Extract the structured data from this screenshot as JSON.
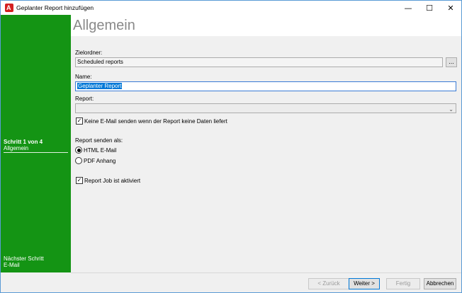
{
  "window": {
    "title": "Geplanter Report hinzufügen",
    "minimize_glyph": "—",
    "maximize_glyph": "☐",
    "close_glyph": "✕"
  },
  "sidebar": {
    "current_step_title": "Schritt 1 von 4",
    "current_step_name": "Allgemein",
    "next_step_title": "Nächster Schritt",
    "next_step_name": "E-Mail",
    "color": "#149414"
  },
  "header": {
    "page_title": "Allgemein"
  },
  "form": {
    "target_folder_label": "Zielordner:",
    "target_folder_value": "Scheduled reports",
    "browse_label": "...",
    "name_label": "Name:",
    "name_value": "Geplanter Report",
    "report_label": "Report:",
    "report_value": "",
    "no_email_checkbox_label": "Keine E-Mail senden wenn der Report keine Daten liefert",
    "no_email_checked": true,
    "send_as_label": "Report senden als:",
    "send_as_options": [
      {
        "label": "HTML E-Mail",
        "selected": true
      },
      {
        "label": "PDF Anhang",
        "selected": false
      }
    ],
    "job_active_label": "Report Job ist aktiviert",
    "job_active_checked": true
  },
  "footer": {
    "back_label": "< Zurück",
    "next_label": "Weiter >",
    "finish_label": "Fertig",
    "cancel_label": "Abbrechen"
  },
  "icons": {
    "app": "app-logo-icon",
    "check": "✓",
    "dropdown": "chevron-down-icon"
  }
}
